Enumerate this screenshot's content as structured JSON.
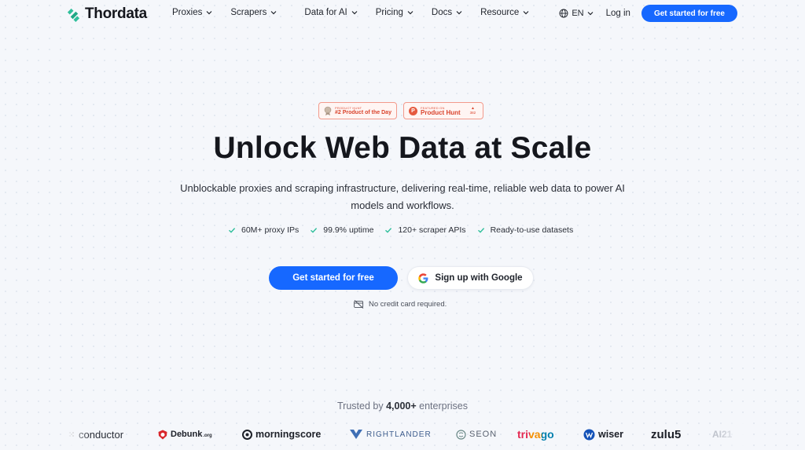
{
  "nav": {
    "logo_text": "Thordata",
    "menu": [
      {
        "label": "Proxies"
      },
      {
        "label": "Scrapers"
      },
      {
        "label": "Data for AI"
      },
      {
        "label": "Pricing"
      },
      {
        "label": "Docs"
      },
      {
        "label": "Resource"
      }
    ],
    "language": "EN",
    "login": "Log in",
    "cta": "Get started for free"
  },
  "badges": {
    "product_day": {
      "small": "PRODUCT HUNT",
      "big": "#2 Product of the Day"
    },
    "featured": {
      "small": "FEATURED ON",
      "big": "Product Hunt",
      "count": "382",
      "logo_letter": "P"
    }
  },
  "hero": {
    "title": "Unlock Web Data at Scale",
    "subtitle": "Unblockable proxies and scraping infrastructure, delivering real-time, reliable web data to power AI models and workflows.",
    "features": [
      "60M+ proxy IPs",
      "99.9% uptime",
      "120+ scraper APIs",
      "Ready-to-use datasets"
    ],
    "cta_primary": "Get started for free",
    "cta_google": "Sign up with Google",
    "no_card": "No credit card required."
  },
  "trusted": {
    "prefix": "Trusted by",
    "count": "4,000+",
    "suffix": "enterprises",
    "logos": {
      "conductor": "conductor",
      "debunk": "Debunk",
      "debunk_suffix": ".org",
      "morningscore": "morningscore",
      "rightlander": "RIGHTLANDER",
      "seon": "SEON",
      "trivago": "trivago",
      "wiser": "wiser",
      "zulu": "zulu5",
      "ai": "AI21"
    }
  },
  "colors": {
    "accent": "#1668ff",
    "check": "#2fbf9b",
    "badge": "#e55a3f"
  }
}
